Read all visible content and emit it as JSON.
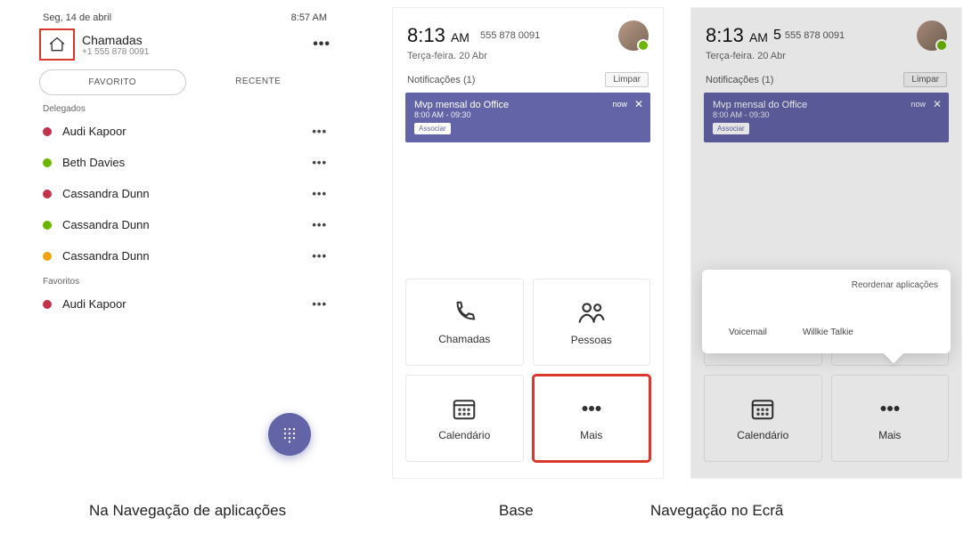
{
  "captions": {
    "left": "Na Navegação de aplicações",
    "mid": "Base",
    "right": "Navegação no Ecrã"
  },
  "p1": {
    "date": "Seg, 14 de abril",
    "time": "8:57 AM",
    "title": "Chamadas",
    "subtitle": "+1 555 878 0091",
    "tabs": {
      "fav": "FAVORITO",
      "recent": "RECENTE"
    },
    "sections": {
      "delegates": "Delegados",
      "favorites": "Favoritos"
    },
    "delegates": [
      {
        "name": "Audi Kapoor",
        "status": "busy"
      },
      {
        "name": "Beth Davies",
        "status": "avail"
      },
      {
        "name": "Cassandra Dunn",
        "status": "busy"
      },
      {
        "name": "Cassandra Dunn",
        "status": "avail"
      },
      {
        "name": "Cassandra Dunn",
        "status": "away"
      }
    ],
    "favorites": [
      {
        "name": "Audi Kapoor",
        "status": "busy"
      }
    ]
  },
  "home": {
    "clock": "8:13",
    "ampm": "AM",
    "phone": "555 878 0091",
    "date": "Terça-feira. 20 Abr",
    "notif_header": "Notificações (1)",
    "clear": "Limpar",
    "notif": {
      "title": "Mvp mensal do Office",
      "time": "8:00 AM - 09:30",
      "badge": "now",
      "join": "Associar"
    },
    "tiles": {
      "calls": "Chamadas",
      "people": "Pessoas",
      "calendar": "Calendário",
      "more": "Mais"
    }
  },
  "p3_extra": "5",
  "popup": {
    "reorder": "Reordenar aplicações",
    "voicemail": "Voicemail",
    "walkie": "Willkie Talkie"
  }
}
